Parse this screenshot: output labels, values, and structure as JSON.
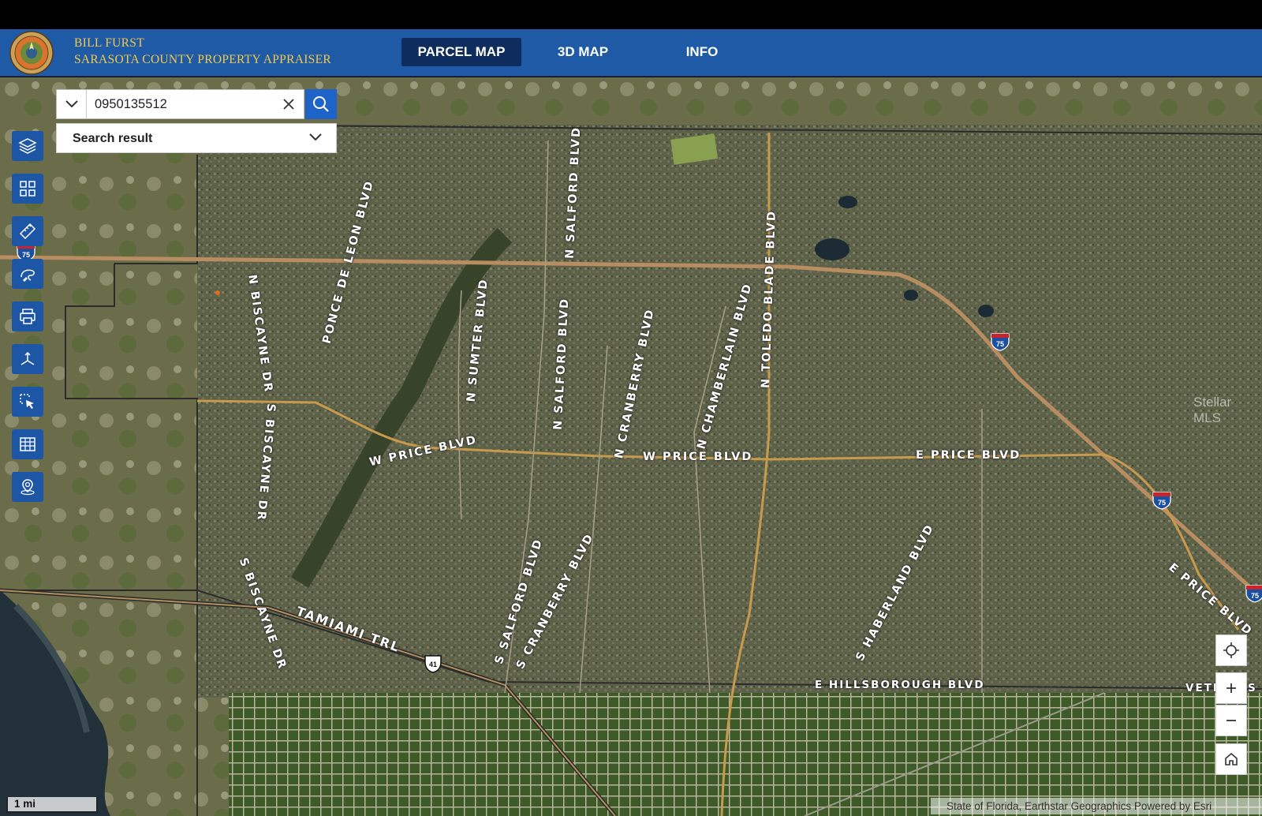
{
  "header": {
    "org_line1": "BILL FURST",
    "org_line2": "SARASOTA COUNTY PROPERTY APPRAISER",
    "tabs": [
      {
        "label": "PARCEL MAP",
        "active": true
      },
      {
        "label": "3D MAP",
        "active": false
      },
      {
        "label": "INFO",
        "active": false
      }
    ]
  },
  "search": {
    "value": "0950135512",
    "result_label": "Search result"
  },
  "toolbar": {
    "items": [
      "layers-icon",
      "basemap-gallery-icon",
      "measure-icon",
      "draw-icon",
      "print-icon",
      "coordinate-icon",
      "select-icon",
      "table-icon",
      "locate-address-icon"
    ]
  },
  "map": {
    "road_labels": [
      "N SALFORD BLVD",
      "PONCE DE LEON BLVD",
      "N TOLEDO BLADE BLVD",
      "N BISCAYNE DR",
      "N SUMTER BLVD",
      "N SALFORD BLVD",
      "N CRANBERRY BLVD",
      "N CHAMBERLAIN BLVD",
      "W PRICE BLVD",
      "W PRICE BLVD",
      "E PRICE BLVD",
      "S BISCAYNE DR",
      "S SALFORD BLVD",
      "S CRANBERRY BLVD",
      "S HABERLAND BLVD",
      "E PRICE BLVD",
      "S BISCAYNE DR",
      "TAMIAMI TRL",
      "E HILLSBOROUGH BLVD",
      "VETE",
      "S"
    ],
    "shields": [
      "75",
      "75",
      "75",
      "41",
      "75"
    ],
    "scale_label": "1 mi",
    "attribution": "State of Florida, Earthstar Geographics    Powered by Esri",
    "watermark": "Stellar MLS"
  },
  "colors": {
    "header_bg": "#1f5aa6",
    "active_tab_bg": "#0e2c5e",
    "org_text": "#f2c94c",
    "tool_button": "#1e56a6",
    "search_button": "#1e64c8"
  }
}
